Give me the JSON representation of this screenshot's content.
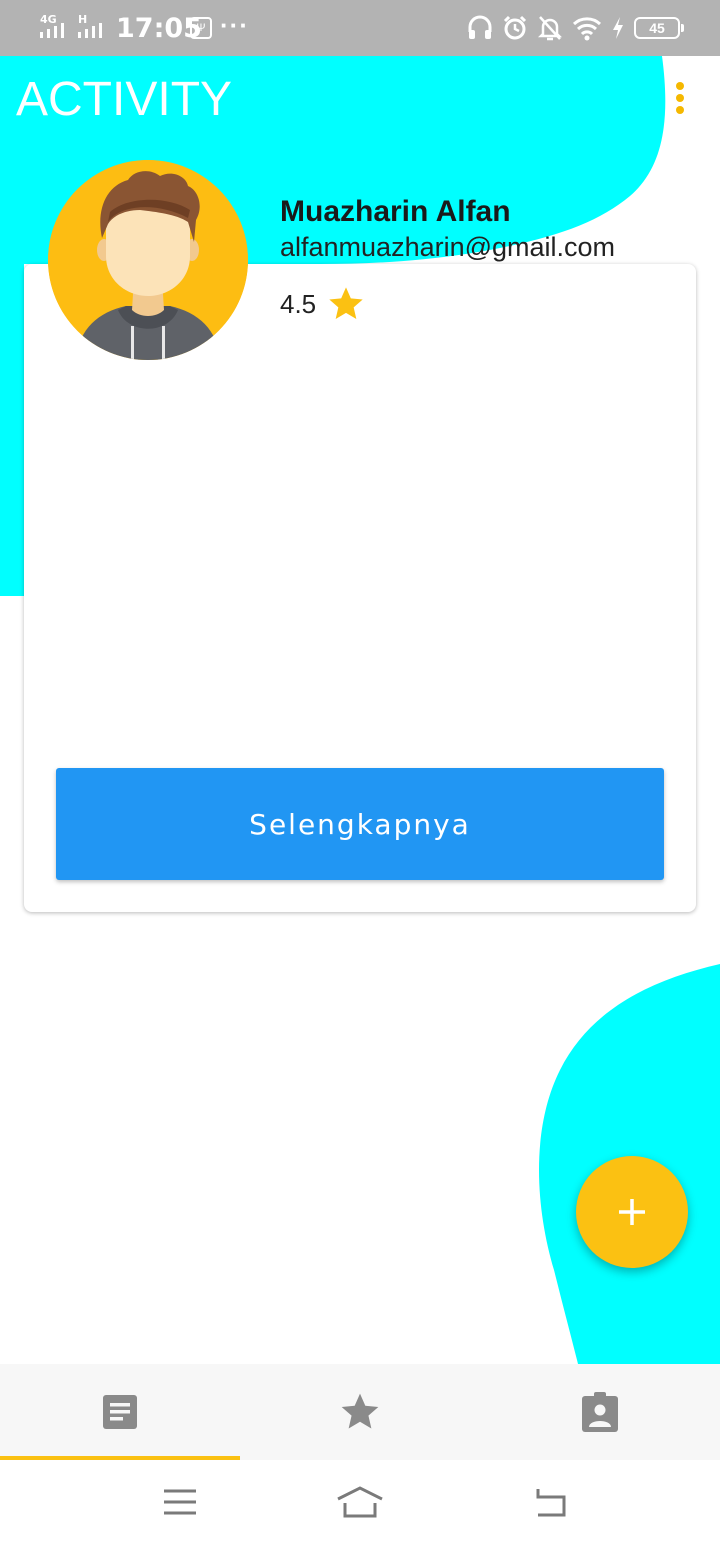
{
  "status_bar": {
    "network_1": "4G",
    "network_2": "H",
    "time": "17:05",
    "usb_glyph": "Ψ",
    "dots": "···",
    "battery": "45",
    "icons": [
      "headphones-icon",
      "alarm-icon",
      "bell-off-icon",
      "wifi-icon",
      "charging-icon",
      "battery-icon"
    ]
  },
  "header": {
    "title": "ACTIVITY",
    "menu_icon": "more-vert-icon"
  },
  "colors": {
    "accent_cyan": "#00ffff",
    "accent_yellow": "#fbc112",
    "button_blue": "#2196f3",
    "status_bar": "#b3b3b3"
  },
  "profile": {
    "name": "Muazharin Alfan",
    "email": "alfanmuazharin@gmail.com",
    "rating": "4.5",
    "avatar_icon": "user-avatar-icon"
  },
  "card": {
    "button_label": "Selengkapnya"
  },
  "fab": {
    "icon": "plus-icon"
  },
  "bottom_nav": {
    "active_index": 0,
    "tabs": [
      {
        "icon": "document-icon"
      },
      {
        "icon": "star-icon"
      },
      {
        "icon": "contact-clipboard-icon"
      }
    ]
  },
  "system_nav": {
    "icons": [
      "menu-icon",
      "home-icon",
      "back-icon"
    ]
  }
}
